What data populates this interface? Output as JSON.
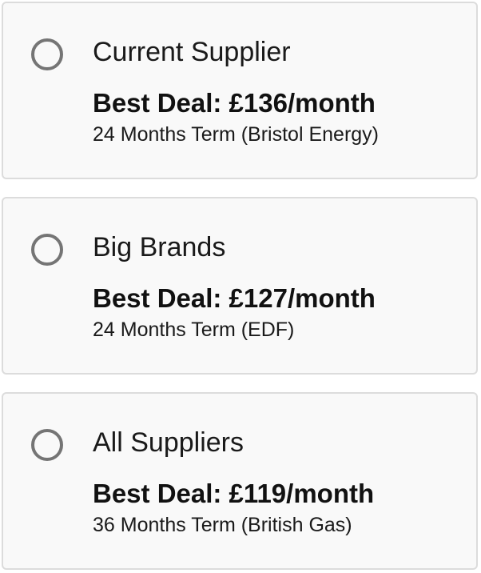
{
  "options": [
    {
      "title": "Current Supplier",
      "best_deal": "Best Deal: £136/month",
      "term": "24 Months Term (Bristol Energy)",
      "selected": false
    },
    {
      "title": "Big Brands",
      "best_deal": "Best Deal: £127/month",
      "term": "24 Months Term (EDF)",
      "selected": false
    },
    {
      "title": "All Suppliers",
      "best_deal": "Best Deal: £119/month",
      "term": "36 Months Term (British Gas)",
      "selected": false
    }
  ],
  "colors": {
    "card_background": "#f9f9f9",
    "card_border": "#dcdcdc",
    "radio_border": "#757575",
    "text": "#111111"
  }
}
